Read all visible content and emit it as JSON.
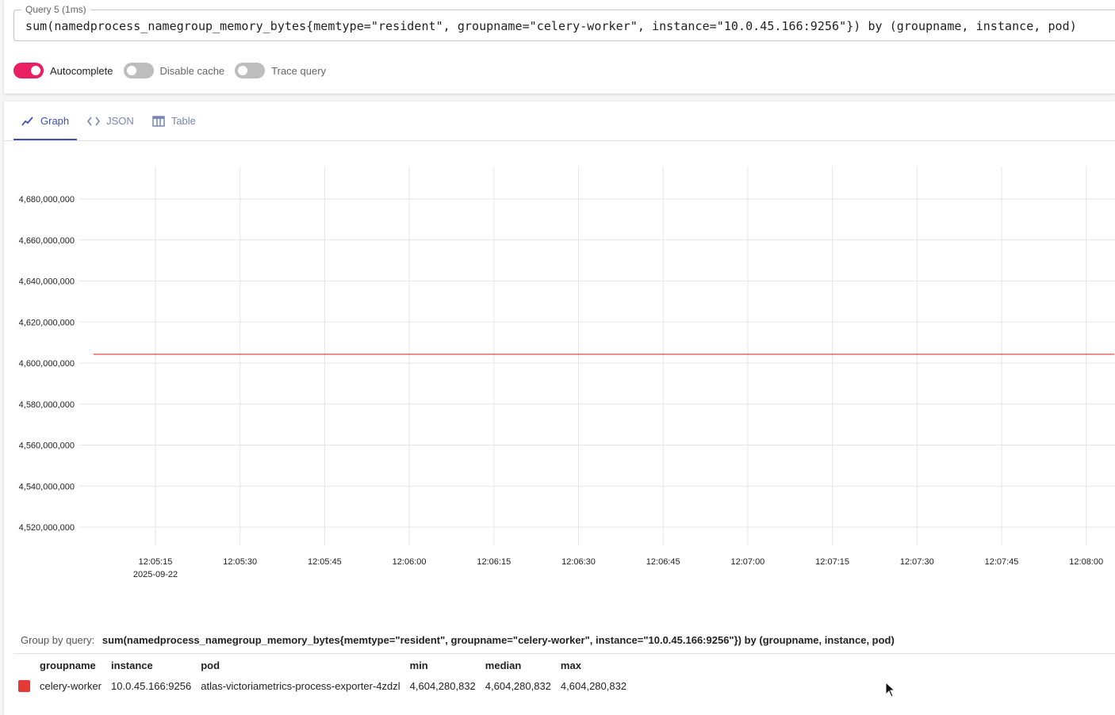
{
  "query": {
    "legend": "Query 5 (1ms)",
    "text": "sum(namedprocess_namegroup_memory_bytes{memtype=\"resident\", groupname=\"celery-worker\", instance=\"10.0.45.166:9256\"}) by (groupname, instance, pod)"
  },
  "switches": [
    {
      "label": "Autocomplete",
      "on": true
    },
    {
      "label": "Disable cache",
      "on": false
    },
    {
      "label": "Trace query",
      "on": false
    }
  ],
  "tabs": [
    {
      "label": "Graph",
      "icon": "chart-line-icon",
      "active": true
    },
    {
      "label": "JSON",
      "icon": "code-icon",
      "active": false
    },
    {
      "label": "Table",
      "icon": "table-icon",
      "active": false
    }
  ],
  "chart_data": {
    "type": "line",
    "y_ticks": [
      "4,520,000,000",
      "4,540,000,000",
      "4,560,000,000",
      "4,580,000,000",
      "4,600,000,000",
      "4,620,000,000",
      "4,640,000,000",
      "4,660,000,000",
      "4,680,000,000"
    ],
    "x_ticks": [
      "12:05:15",
      "12:05:30",
      "12:05:45",
      "12:06:00",
      "12:06:15",
      "12:06:30",
      "12:06:45",
      "12:07:00",
      "12:07:15",
      "12:07:30",
      "12:07:45",
      "12:08:00"
    ],
    "x_date_label": "2025-09-22",
    "ylim": [
      4520000000,
      4680000000
    ],
    "grid": true,
    "series": [
      {
        "color": "#e53935",
        "x": [
          "12:05:04",
          "12:08:05"
        ],
        "values": [
          4604280832,
          4604280832
        ]
      }
    ]
  },
  "group_by": {
    "label": "Group by query:",
    "query": "sum(namedprocess_namegroup_memory_bytes{memtype=\"resident\", groupname=\"celery-worker\", instance=\"10.0.45.166:9256\"}) by (groupname, instance, pod)"
  },
  "legend_table": {
    "columns": [
      "groupname",
      "instance",
      "pod",
      "min",
      "median",
      "max"
    ],
    "rows": [
      {
        "color": "#e53935",
        "cells": [
          "celery-worker",
          "10.0.45.166:9256",
          "atlas-victoriametrics-process-exporter-4zdzl",
          "4,604,280,832",
          "4,604,280,832",
          "4,604,280,832"
        ]
      }
    ]
  }
}
